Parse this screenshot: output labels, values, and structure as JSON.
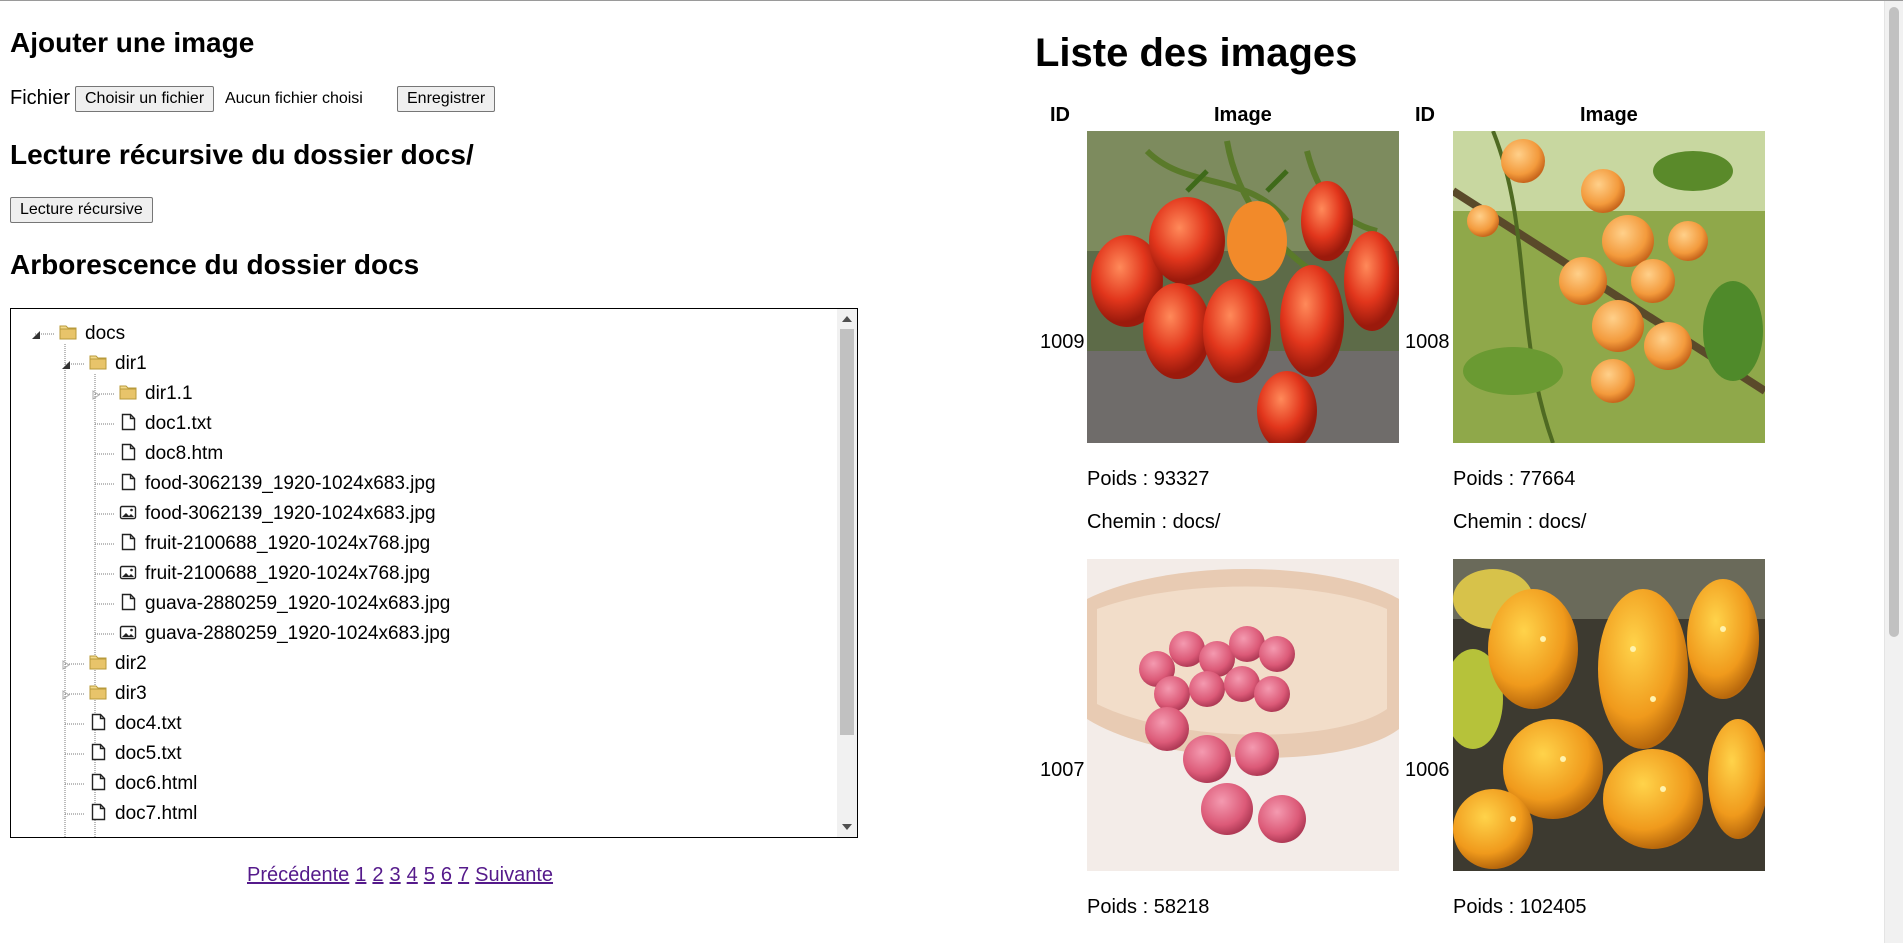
{
  "upload": {
    "title": "Ajouter une image",
    "file_label": "Fichier",
    "choose_button": "Choisir un fichier",
    "no_file": "Aucun fichier choisi",
    "save_button": "Enregistrer"
  },
  "recursive": {
    "title": "Lecture récursive du dossier docs/",
    "button": "Lecture récursive"
  },
  "tree": {
    "title": "Arborescence du dossier docs",
    "nodes": [
      {
        "label": "docs",
        "type": "folder",
        "depth": 0,
        "expanded": true
      },
      {
        "label": "dir1",
        "type": "folder",
        "depth": 1,
        "expanded": true
      },
      {
        "label": "dir1.1",
        "type": "folder",
        "depth": 2,
        "expanded": false
      },
      {
        "label": "doc1.txt",
        "type": "file",
        "depth": 2
      },
      {
        "label": "doc8.htm",
        "type": "file",
        "depth": 2
      },
      {
        "label": "food-3062139_1920-1024x683.jpg",
        "type": "file",
        "depth": 2
      },
      {
        "label": "food-3062139_1920-1024x683.jpg",
        "type": "image",
        "depth": 2
      },
      {
        "label": "fruit-2100688_1920-1024x768.jpg",
        "type": "file",
        "depth": 2
      },
      {
        "label": "fruit-2100688_1920-1024x768.jpg",
        "type": "image",
        "depth": 2
      },
      {
        "label": "guava-2880259_1920-1024x683.jpg",
        "type": "file",
        "depth": 2
      },
      {
        "label": "guava-2880259_1920-1024x683.jpg",
        "type": "image",
        "depth": 2
      },
      {
        "label": "dir2",
        "type": "folder",
        "depth": 1,
        "expanded": false
      },
      {
        "label": "dir3",
        "type": "folder",
        "depth": 1,
        "expanded": false
      },
      {
        "label": "doc4.txt",
        "type": "file",
        "depth": 1
      },
      {
        "label": "doc5.txt",
        "type": "file",
        "depth": 1
      },
      {
        "label": "doc6.html",
        "type": "file",
        "depth": 1
      },
      {
        "label": "doc7.html",
        "type": "file",
        "depth": 1
      }
    ]
  },
  "pagination": {
    "prev": "Précédente",
    "pages": [
      "1",
      "2",
      "3",
      "4",
      "5",
      "6",
      "7"
    ],
    "next": "Suivante"
  },
  "list": {
    "title": "Liste des images",
    "col_id": "ID",
    "col_image": "Image",
    "poids_label": "Poids : ",
    "chemin_label": "Chemin : ",
    "images": [
      {
        "id": "1009",
        "poids": "93327",
        "chemin": "docs/",
        "subject": "tomatoes"
      },
      {
        "id": "1008",
        "poids": "77664",
        "chemin": "docs/",
        "subject": "apricots"
      },
      {
        "id": "1007",
        "poids": "58218",
        "subject": "lychees"
      },
      {
        "id": "1006",
        "poids": "102405",
        "subject": "kiwano"
      }
    ]
  },
  "colors": {
    "link": "#551a8b",
    "button_bg": "#efefef",
    "folder": "#e8c46a"
  },
  "icons": {
    "folder": "folder-icon",
    "file": "file-icon",
    "image": "image-file-icon"
  }
}
